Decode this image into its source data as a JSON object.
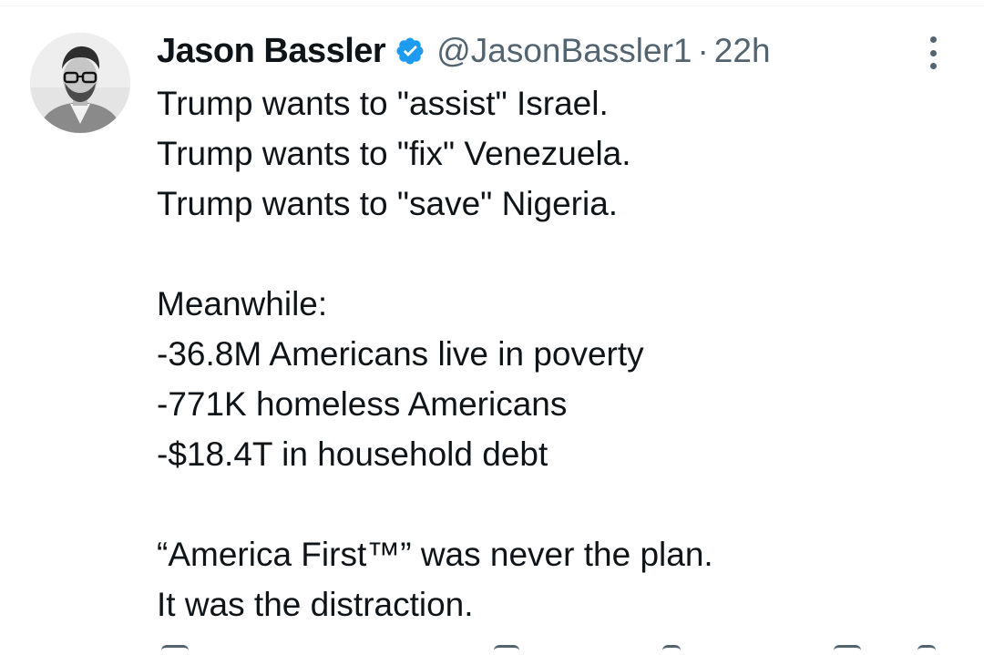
{
  "author": {
    "name": "Jason Bassler",
    "handle": "@JasonBassler1",
    "separator": "·",
    "time": "22h"
  },
  "icons": {
    "verified": "verified-badge-icon",
    "more": "more-options-icon",
    "avatar": "profile-photo"
  },
  "colors": {
    "verified_blue": "#1d9bf0",
    "secondary_text": "#536471",
    "primary_text": "#0f1419"
  },
  "post": {
    "lines": [
      "Trump wants to \"assist\" Israel.",
      "Trump wants to \"fix\" Venezuela.",
      "Trump wants to \"save\" Nigeria.",
      "",
      "Meanwhile:",
      "-36.8M Americans live in poverty",
      "-771K homeless Americans",
      "-$18.4T in household debt",
      "",
      "“America First™” was never the plan.",
      "It was the distraction."
    ]
  }
}
